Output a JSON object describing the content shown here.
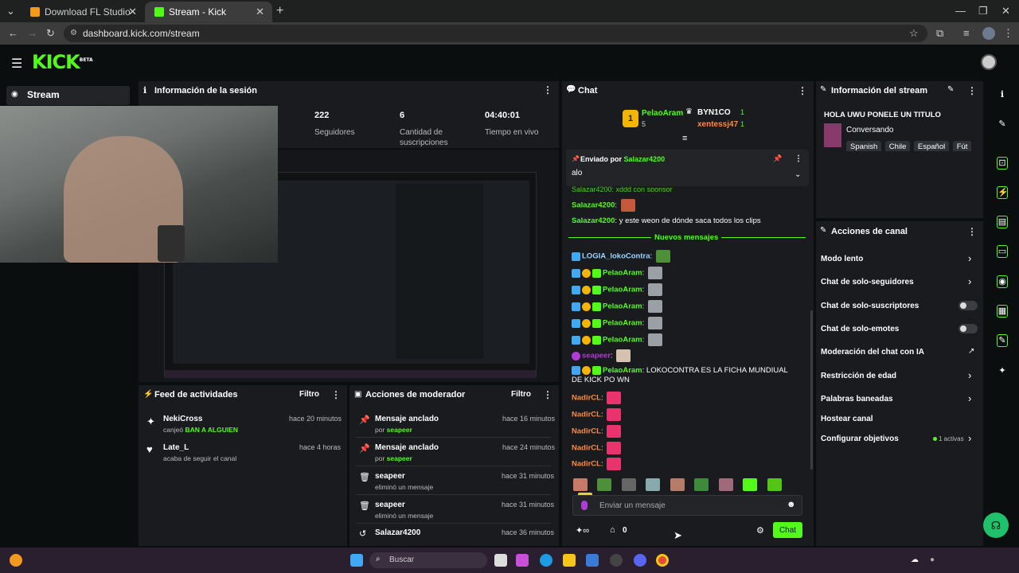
{
  "browser": {
    "tabs": [
      {
        "label": "Download FL Studio"
      },
      {
        "label": "Stream - Kick Dashboard"
      }
    ],
    "url": "dashboard.kick.com/stream"
  },
  "header": {
    "logo": "KICK",
    "logo_tag": "BETA"
  },
  "sidebar": {
    "stream_label": "Stream"
  },
  "session": {
    "title": "Información de la sesión",
    "stats": [
      {
        "value": "222",
        "label": "Seguidores"
      },
      {
        "value": "6",
        "label": "Cantidad de suscripciones"
      },
      {
        "value": "04:40:01",
        "label": "Tiempo en vivo"
      }
    ]
  },
  "feed": {
    "title": "Feed de actividades",
    "filter": "Filtro",
    "items": [
      {
        "name": "NekiCross",
        "sub_prefix": "canjeó",
        "sub_highlight": "BAN A ALGUIEN",
        "time": "hace 20 minutos"
      },
      {
        "name": "Late_L",
        "sub_prefix": "acaba de seguir el canal",
        "sub_highlight": "",
        "time": "hace 4 horas"
      }
    ]
  },
  "modactions": {
    "title": "Acciones de moderador",
    "filter": "Filtro",
    "items": [
      {
        "name": "Mensaje anclado",
        "sub_prefix": "por",
        "sub_user": "seapeer",
        "time": "hace 16 minutos"
      },
      {
        "name": "Mensaje anclado",
        "sub_prefix": "por",
        "sub_user": "seapeer",
        "time": "hace 24 minutos"
      },
      {
        "name": "seapeer",
        "sub_prefix": "eliminó un mensaje",
        "sub_user": "",
        "time": "hace 31 minutos"
      },
      {
        "name": "seapeer",
        "sub_prefix": "eliminó un mensaje",
        "sub_user": "",
        "time": "hace 31 minutos"
      },
      {
        "name": "Salazar4200",
        "sub_prefix": "",
        "sub_user": "",
        "time": "hace 36 minutos"
      }
    ]
  },
  "chat": {
    "title": "Chat",
    "leaderboard": {
      "first_name": "PelaoAram",
      "first_rank": "1",
      "first_count": "5",
      "second_name": "BYN1CO",
      "second_count": "1",
      "third_name": "xentessj47",
      "third_count": "1"
    },
    "pinned": {
      "label": "Enviado por",
      "user": "Salazar4200",
      "message": "alo"
    },
    "partial_line": "Salazar4200: xddd con sponsor",
    "messages": [
      {
        "user": "Salazar4200",
        "text": ""
      },
      {
        "user": "Salazar4200",
        "text": "y este weon de dónde saca todos los clips"
      }
    ],
    "divider": "Nuevos mensajes",
    "new_messages": [
      {
        "user": "LOGIA_lokoContra",
        "text": "",
        "color": "#9ad6ff"
      },
      {
        "user": "PelaoAram",
        "text": "",
        "color": "#53fc18"
      },
      {
        "user": "PelaoAram",
        "text": "",
        "color": "#53fc18"
      },
      {
        "user": "PelaoAram",
        "text": "",
        "color": "#53fc18"
      },
      {
        "user": "PelaoAram",
        "text": "",
        "color": "#53fc18"
      },
      {
        "user": "PelaoAram",
        "text": "",
        "color": "#53fc18"
      },
      {
        "user": "seapeer",
        "text": "",
        "color": "#b03bd6"
      },
      {
        "user": "PelaoAram",
        "text": "LOKOCONTRA ES LA FICHA MUNDIUAL DE KICK PO WN",
        "color": "#53fc18"
      },
      {
        "user": "NadirCL",
        "text": "",
        "color": "#ff8a3d"
      },
      {
        "user": "NadirCL",
        "text": "",
        "color": "#ff8a3d"
      },
      {
        "user": "NadirCL",
        "text": "",
        "color": "#ff8a3d"
      },
      {
        "user": "NadirCL",
        "text": "",
        "color": "#ff8a3d"
      },
      {
        "user": "NadirCL",
        "text": "",
        "color": "#ff8a3d"
      }
    ],
    "input_placeholder": "Enviar un mensaje",
    "points": "0",
    "send_label": "Chat"
  },
  "streaminfo": {
    "title": "Información del stream",
    "stream_title": "HOLA UWU PONELE UN TITULO",
    "category": "Conversando",
    "tags": [
      "Spanish",
      "Chile",
      "Español",
      "Fút"
    ]
  },
  "channel_actions": {
    "title": "Acciones de canal",
    "items": [
      {
        "label": "Modo lento",
        "control": "chevron"
      },
      {
        "label": "Chat de solo-seguidores",
        "control": "chevron"
      },
      {
        "label": "Chat de solo-suscriptores",
        "control": "toggle"
      },
      {
        "label": "Chat de solo-emotes",
        "control": "toggle"
      },
      {
        "label": "Moderación del chat con IA",
        "control": "external"
      },
      {
        "label": "Restricción de edad",
        "control": "chevron"
      },
      {
        "label": "Palabras baneadas",
        "control": "chevron"
      },
      {
        "label": "Hostear canal",
        "control": "none"
      },
      {
        "label": "Configurar objetivos",
        "control": "chevron"
      }
    ],
    "goals_badge": "1 activas"
  },
  "taskbar": {
    "search_placeholder": "Buscar"
  },
  "colors": {
    "accent": "#53fc18",
    "panel": "#191b1f",
    "background": "#0b0e0f"
  }
}
